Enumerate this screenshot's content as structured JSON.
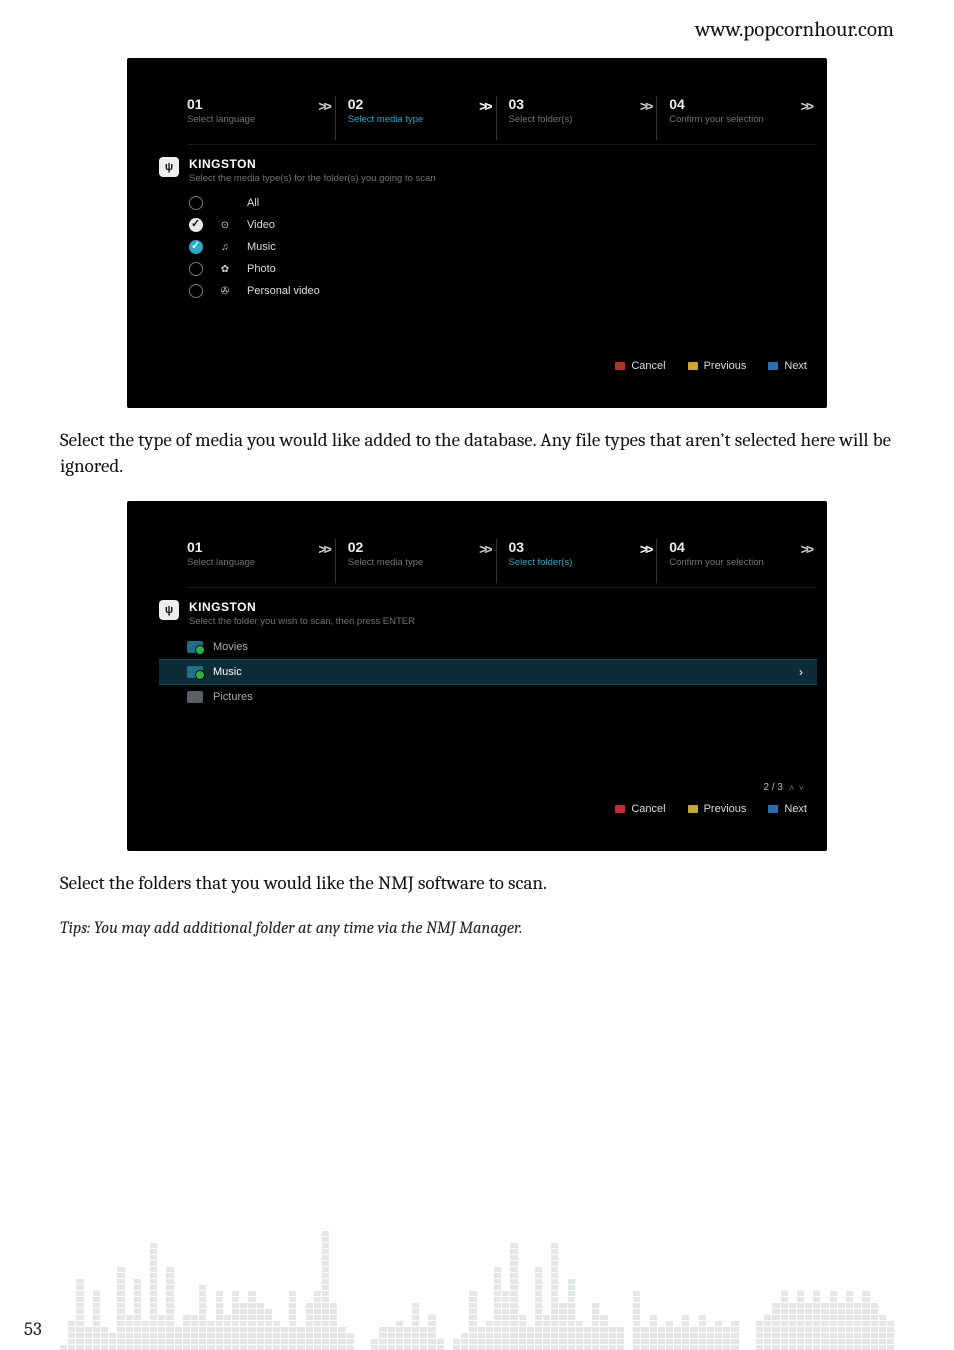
{
  "header": {
    "url": "www.popcornhour.com"
  },
  "steps": {
    "s1": {
      "num": "01",
      "label": "Select language"
    },
    "s2": {
      "num": "02",
      "label": "Select media type"
    },
    "s3": {
      "num": "03",
      "label": "Select folder(s)"
    },
    "s4": {
      "num": "04",
      "label": "Confirm your selection"
    },
    "chev": ">>"
  },
  "shot1": {
    "active_step": 2,
    "device": "KINGSTON",
    "subtitle": "Select the media type(s) for the folder(s) you going to scan",
    "options": {
      "all": {
        "label": "All",
        "icon": "",
        "checked": false
      },
      "video": {
        "label": "Video",
        "icon": "⊙",
        "checked": true,
        "blue": false
      },
      "music": {
        "label": "Music",
        "icon": "♫",
        "checked": true,
        "blue": true
      },
      "photo": {
        "label": "Photo",
        "icon": "✿",
        "checked": false
      },
      "pvid": {
        "label": "Personal video",
        "icon": "✇",
        "checked": false
      }
    }
  },
  "shot2": {
    "active_step": 3,
    "device": "KINGSTON",
    "subtitle": "Select the folder you wish to scan, then press ENTER",
    "folders": {
      "f1": {
        "label": "Movies",
        "selected": false,
        "checked": true
      },
      "f2": {
        "label": "Music",
        "selected": true,
        "checked": true
      },
      "f3": {
        "label": "Pictures",
        "selected": false,
        "checked": false
      }
    },
    "counter": "2 / 3"
  },
  "buttons": {
    "cancel": "Cancel",
    "previous": "Previous",
    "next": "Next"
  },
  "body": {
    "para1": "Select the type of media you would like added to the database. Any file types that aren’t selected here will be ignored.",
    "para2": "Select the folders that you would like the NMJ software to scan.",
    "tips": "Tips: You may add additional folder at any time via the NMJ Manager."
  },
  "page_number": "53",
  "chart_data": {
    "type": "bar",
    "title": "",
    "xlabel": "",
    "ylabel": "",
    "ylim": [
      0,
      22
    ],
    "note": "Decorative equalizer-style footer; heights estimated in cell units.",
    "values": [
      1,
      5,
      12,
      4,
      10,
      4,
      3,
      14,
      6,
      12,
      5,
      18,
      6,
      14,
      4,
      6,
      6,
      11,
      5,
      10,
      6,
      10,
      8,
      10,
      8,
      7,
      5,
      4,
      10,
      4,
      8,
      10,
      20,
      8,
      4,
      3,
      0,
      0,
      2,
      4,
      4,
      5,
      4,
      8,
      4,
      6,
      2,
      0,
      2,
      3,
      10,
      4,
      5,
      14,
      10,
      18,
      6,
      4,
      14,
      6,
      18,
      8,
      12,
      5,
      4,
      8,
      6,
      4,
      4,
      0,
      10,
      4,
      6,
      4,
      5,
      4,
      6,
      4,
      6,
      4,
      5,
      4,
      5,
      0,
      0,
      5,
      6,
      8,
      10,
      8,
      10,
      8,
      10,
      8,
      10,
      8,
      10,
      8,
      10,
      8,
      6,
      5
    ]
  }
}
